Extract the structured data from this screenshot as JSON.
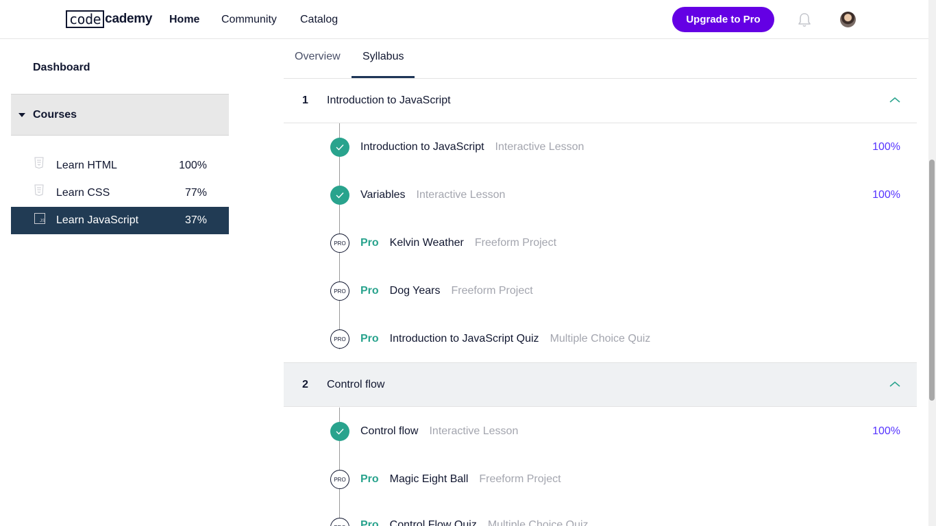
{
  "header": {
    "logo_boxed": "code",
    "logo_rest": "cademy",
    "nav": {
      "home": "Home",
      "community": "Community",
      "catalog": "Catalog"
    },
    "upgrade_label": "Upgrade to Pro",
    "icons": {
      "bell": "bell-icon",
      "avatar": "avatar"
    }
  },
  "sidebar": {
    "dashboard": "Dashboard",
    "courses_label": "Courses",
    "courses": [
      {
        "name": "Learn HTML",
        "percent": "100%",
        "icon": "html-file-icon"
      },
      {
        "name": "Learn CSS",
        "percent": "77%",
        "icon": "css-file-icon"
      },
      {
        "name": "Learn JavaScript",
        "percent": "37%",
        "icon": "js-file-icon",
        "active": true
      }
    ]
  },
  "tabs": {
    "overview": "Overview",
    "syllabus": "Syllabus",
    "selected": "Syllabus"
  },
  "modules": [
    {
      "number": "1",
      "title": "Introduction to JavaScript",
      "items": [
        {
          "status": "complete",
          "pro": "",
          "name": "Introduction to JavaScript",
          "type": "Interactive Lesson",
          "percent": "100%"
        },
        {
          "status": "complete",
          "pro": "",
          "name": "Variables",
          "type": "Interactive Lesson",
          "percent": "100%"
        },
        {
          "status": "pro",
          "pro": "Pro",
          "name": "Kelvin Weather",
          "type": "Freeform Project",
          "percent": ""
        },
        {
          "status": "pro",
          "pro": "Pro",
          "name": "Dog Years",
          "type": "Freeform Project",
          "percent": ""
        },
        {
          "status": "pro",
          "pro": "Pro",
          "name": "Introduction to JavaScript Quiz",
          "type": "Multiple Choice Quiz",
          "percent": ""
        }
      ]
    },
    {
      "number": "2",
      "title": "Control flow",
      "items": [
        {
          "status": "complete",
          "pro": "",
          "name": "Control flow",
          "type": "Interactive Lesson",
          "percent": "100%"
        },
        {
          "status": "pro",
          "pro": "Pro",
          "name": "Magic Eight Ball",
          "type": "Freeform Project",
          "percent": ""
        },
        {
          "status": "pro",
          "pro": "Pro",
          "name": "Control Flow Quiz",
          "type": "Multiple Choice Quiz",
          "percent": ""
        }
      ]
    }
  ],
  "pro_badge_text": "PRO",
  "colors": {
    "accent": "#6400e4",
    "success": "#29a38d",
    "navy": "#10162f",
    "active_bg": "#213b54"
  }
}
